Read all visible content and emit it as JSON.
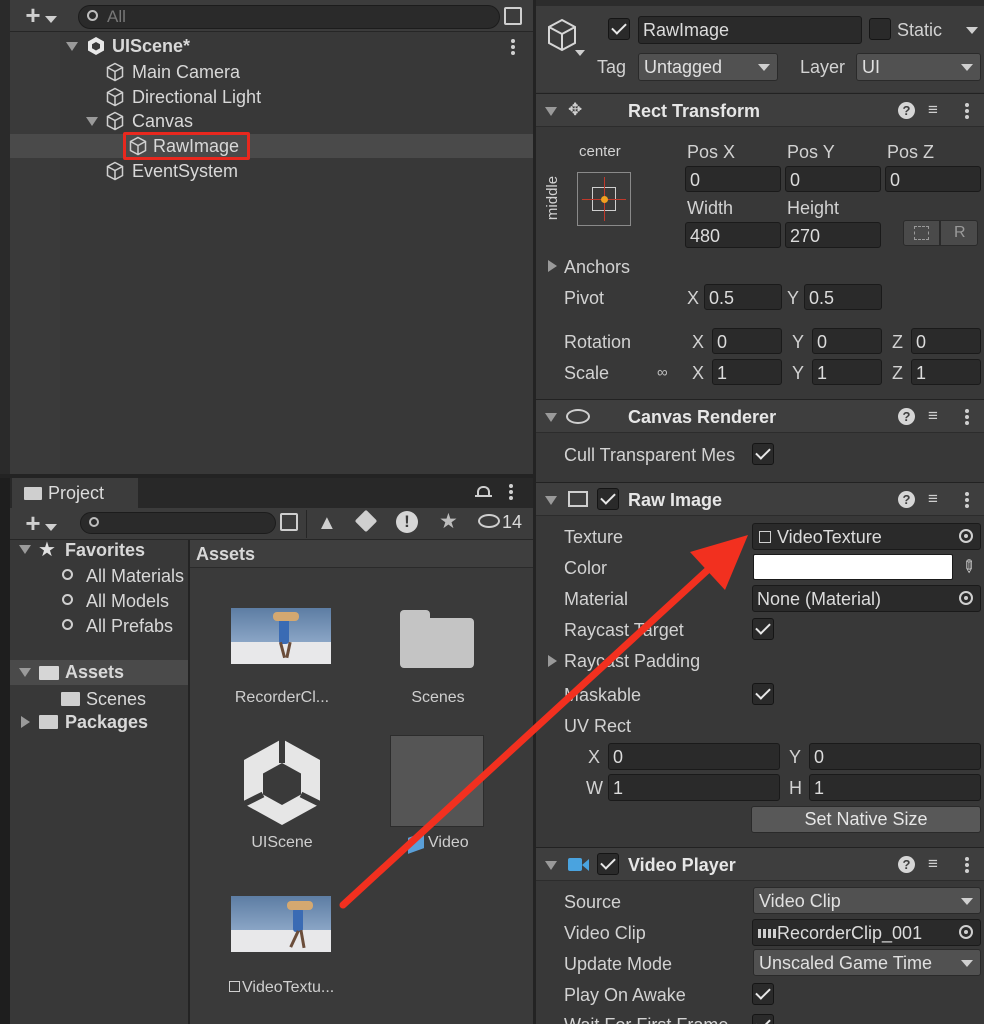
{
  "hierarchy": {
    "search_placeholder": "All",
    "scene_name": "UIScene*",
    "items": [
      {
        "label": "Main Camera"
      },
      {
        "label": "Directional Light"
      },
      {
        "label": "Canvas"
      },
      {
        "label": "RawImage"
      },
      {
        "label": "EventSystem"
      }
    ]
  },
  "project": {
    "tab_label": "Project",
    "hidden_count": "14",
    "tree": {
      "favorites": "Favorites",
      "fav_items": [
        "All Materials",
        "All Models",
        "All Prefabs"
      ],
      "assets": "Assets",
      "scenes": "Scenes",
      "packages": "Packages"
    },
    "breadcrumb": "Assets",
    "assets": [
      {
        "label": "RecorderCl..."
      },
      {
        "label": "Scenes"
      },
      {
        "label": "UIScene"
      },
      {
        "label": "Video"
      },
      {
        "label": "VideoTextu..."
      }
    ]
  },
  "inspector": {
    "object_name": "RawImage",
    "static_label": "Static",
    "tag_label": "Tag",
    "tag_value": "Untagged",
    "layer_label": "Layer",
    "layer_value": "UI",
    "rect_transform": {
      "title": "Rect Transform",
      "anchor_h": "center",
      "anchor_v": "middle",
      "posx_label": "Pos X",
      "posx": "0",
      "posy_label": "Pos Y",
      "posy": "0",
      "posz_label": "Pos Z",
      "posz": "0",
      "width_label": "Width",
      "width": "480",
      "height_label": "Height",
      "height": "270",
      "r_button": "R",
      "anchors_label": "Anchors",
      "pivot_label": "Pivot",
      "pivot_x": "0.5",
      "pivot_y": "0.5",
      "rotation_label": "Rotation",
      "rot_x": "0",
      "rot_y": "0",
      "rot_z": "0",
      "scale_label": "Scale",
      "scale_x": "1",
      "scale_y": "1",
      "scale_z": "1",
      "x": "X",
      "y": "Y",
      "z": "Z"
    },
    "canvas_renderer": {
      "title": "Canvas Renderer",
      "cull_label": "Cull Transparent Mes"
    },
    "raw_image": {
      "title": "Raw Image",
      "texture_label": "Texture",
      "texture_value": "VideoTexture",
      "color_label": "Color",
      "material_label": "Material",
      "material_value": "None (Material)",
      "raycast_target_label": "Raycast Target",
      "raycast_padding_label": "Raycast Padding",
      "maskable_label": "Maskable",
      "uvrect_label": "UV Rect",
      "uv_x_label": "X",
      "uv_x": "0",
      "uv_y_label": "Y",
      "uv_y": "0",
      "uv_w_label": "W",
      "uv_w": "1",
      "uv_h_label": "H",
      "uv_h": "1",
      "set_native_size": "Set Native Size"
    },
    "video_player": {
      "title": "Video Player",
      "source_label": "Source",
      "source_value": "Video Clip",
      "clip_label": "Video Clip",
      "clip_value": "RecorderClip_001",
      "update_label": "Update Mode",
      "update_value": "Unscaled Game Time",
      "play_label": "Play On Awake",
      "wait_label": "Wait For First Frame"
    }
  },
  "colors": {
    "highlight_box": "#e8281e",
    "arrow": "#f2301f",
    "panel_bg": "#383838"
  }
}
